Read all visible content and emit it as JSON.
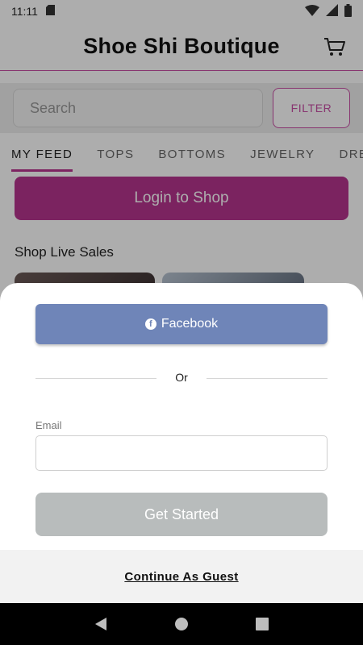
{
  "status_bar": {
    "time": "11:11",
    "icons": [
      "sd-card-icon",
      "wifi-icon",
      "signal-icon",
      "battery-icon"
    ]
  },
  "header": {
    "title": "Shoe Shi Boutique",
    "cart_icon": "cart-icon"
  },
  "search": {
    "placeholder": "Search",
    "filter_label": "FILTER"
  },
  "tabs": [
    {
      "label": "MY FEED",
      "active": true
    },
    {
      "label": "TOPS",
      "active": false
    },
    {
      "label": "BOTTOMS",
      "active": false
    },
    {
      "label": "JEWELRY",
      "active": false
    },
    {
      "label": "DRES",
      "active": false
    }
  ],
  "feed": {
    "login_button": "Login to Shop",
    "section_title": "Shop Live Sales"
  },
  "sheet": {
    "facebook_label": "Facebook",
    "divider_text": "Or",
    "email_label": "Email",
    "email_value": "",
    "get_started_label": "Get Started",
    "guest_label": "Continue As Guest"
  },
  "colors": {
    "brand": "#b5348e",
    "facebook": "#6f85b8",
    "disabled": "#b8bcbc"
  }
}
